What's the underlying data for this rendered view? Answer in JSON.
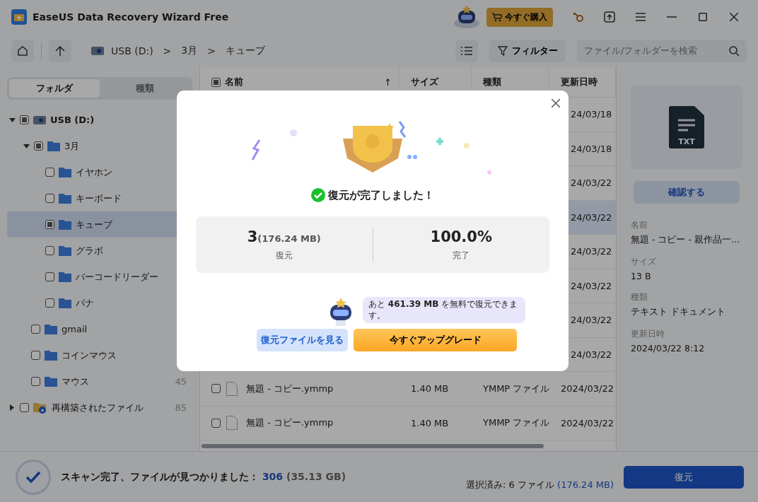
{
  "window": {
    "title": "EaseUS Data Recovery Wizard Free",
    "buy_button": "今すぐ購入"
  },
  "toolbar": {
    "breadcrumb": [
      "USB (D:)",
      "3月",
      "キューブ"
    ],
    "separators": [
      ">",
      ">"
    ],
    "filter_button": "フィルター",
    "search": {
      "placeholder": "ファイル/フォルダーを検索"
    }
  },
  "sidebar": {
    "tabs": [
      {
        "label": "フォルダ",
        "selected": true
      },
      {
        "label": "種類",
        "selected": false
      }
    ],
    "tree": [
      {
        "label": "USB (D:)",
        "kind": "drive",
        "partial": true,
        "expanded": true,
        "selected": false,
        "children": [
          {
            "label": "3月",
            "kind": "folder",
            "partial": true,
            "expanded": true,
            "selected": false,
            "children": [
              {
                "label": "イヤホン",
                "kind": "folder",
                "partial": false,
                "selected": false
              },
              {
                "label": "キーボード",
                "kind": "folder",
                "partial": false,
                "selected": false
              },
              {
                "label": "キューブ",
                "kind": "folder",
                "partial": true,
                "selected": true
              },
              {
                "label": "グラボ",
                "kind": "folder",
                "partial": false,
                "selected": false
              },
              {
                "label": "バーコードリーダー",
                "kind": "folder",
                "partial": false,
                "selected": false
              },
              {
                "label": "パナ",
                "kind": "folder",
                "partial": false,
                "selected": false
              }
            ]
          },
          {
            "label": "gmail",
            "kind": "folder",
            "partial": false,
            "selected": false
          },
          {
            "label": "コインマウス",
            "kind": "folder",
            "partial": false,
            "selected": false
          },
          {
            "label": "マウス",
            "kind": "folder",
            "partial": false,
            "selected": false,
            "count": "45"
          }
        ]
      },
      {
        "label": "再構築されたファイル",
        "kind": "rebuilt",
        "partial": false,
        "expanded": false,
        "selected": false,
        "count": "85"
      }
    ]
  },
  "table": {
    "columns": [
      "名前",
      "サイズ",
      "種類",
      "更新日時"
    ],
    "sort_arrow": "↑",
    "rows": [
      {
        "kind": "covered",
        "selected": false,
        "modified": "24/03/18"
      },
      {
        "kind": "covered",
        "selected": false,
        "modified": "24/03/18"
      },
      {
        "kind": "covered",
        "selected": false,
        "modified": "24/03/22"
      },
      {
        "kind": "covered",
        "selected": true,
        "modified": "24/03/22"
      },
      {
        "kind": "covered",
        "selected": false,
        "modified": "24/03/22"
      },
      {
        "kind": "covered",
        "selected": false,
        "modified": "24/03/22"
      },
      {
        "kind": "covered",
        "selected": false,
        "modified": "24/03/22"
      },
      {
        "kind": "covered",
        "selected": false,
        "modified": "24/03/22"
      },
      {
        "kind": "full",
        "selected": false,
        "name": "無題 - コピー.ymmp",
        "size": "1.40 MB",
        "type": "YMMP ファイル",
        "modified": "2024/03/22"
      },
      {
        "kind": "full",
        "selected": false,
        "name": "無題 - コピー.ymmp",
        "size": "1.40 MB",
        "type": "YMMP ファイル",
        "modified": "2024/03/22"
      }
    ]
  },
  "preview": {
    "badge": "TXT",
    "button": "確認する",
    "details": [
      {
        "label": "名前",
        "value": "無題 - コピー - 親作品一…"
      },
      {
        "label": "サイズ",
        "value": "13 B"
      },
      {
        "label": "種類",
        "value": "テキスト ドキュメント"
      },
      {
        "label": "更新日時",
        "value": "2024/03/22 8:12"
      }
    ]
  },
  "status_bar": {
    "scan_text": "スキャン完了、ファイルが見つかりました：",
    "found_count": "306",
    "found_size": "(35.13 GB)",
    "selected_text": "選択済み: 6 ファイル",
    "selected_size": "(176.24 MB)",
    "recover_button": "復元"
  },
  "dialog": {
    "title": "復元が完了しました！",
    "stats": [
      {
        "value": "3",
        "extra": "(176.24 MB)",
        "label": "復元"
      },
      {
        "value": "100.0%",
        "label": "完了"
      }
    ],
    "bubble": "あと **461.39 MB** を無料で復元できます。",
    "view_button": "復元ファイルを見る",
    "upgrade_button": "今すぐアップグレード"
  }
}
